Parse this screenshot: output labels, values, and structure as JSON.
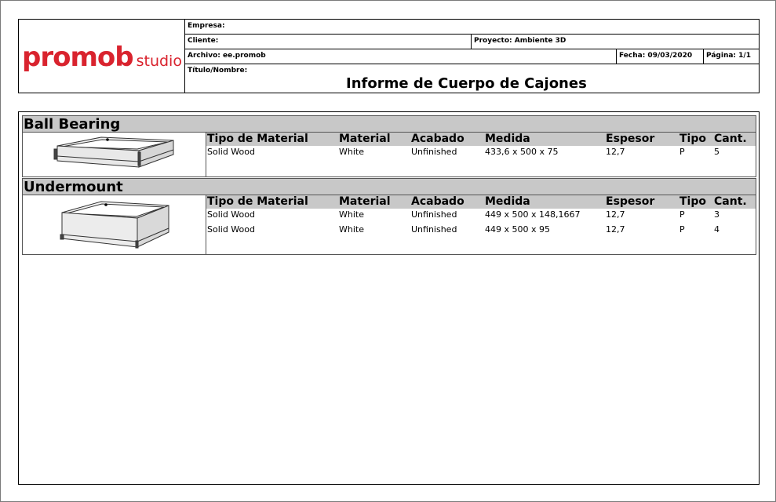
{
  "header": {
    "logo_brand": "promob",
    "logo_sub": "studio",
    "empresa_label": "Empresa:",
    "cliente_label": "Cliente:",
    "proyecto_label": "Proyecto: Ambiente 3D",
    "archivo_label": "Archivo: ee.promob",
    "fecha_label": "Fecha: 09/03/2020",
    "pagina_label": "Página: 1/1",
    "titulo_label": "Título/Nombre:",
    "report_title": "Informe de Cuerpo de Cajones"
  },
  "columns": [
    "Tipo de Material",
    "Material",
    "Acabado",
    "Medida",
    "Espesor",
    "Tipo",
    "Cant."
  ],
  "sections": [
    {
      "title": "Ball Bearing",
      "rows": [
        [
          "Solid Wood",
          "White",
          "Unfinished",
          "433,6 x 500 x 75",
          "12,7",
          "P",
          "5"
        ]
      ]
    },
    {
      "title": "Undermount",
      "rows": [
        [
          "Solid Wood",
          "White",
          "Unfinished",
          "449 x 500 x 148,1667",
          "12,7",
          "P",
          "3"
        ],
        [
          "Solid Wood",
          "White",
          "Unfinished",
          "449 x 500 x 95",
          "12,7",
          "P",
          "4"
        ]
      ]
    }
  ],
  "colors": {
    "brand": "#d9232e",
    "header_fill": "#c8c8c8"
  }
}
